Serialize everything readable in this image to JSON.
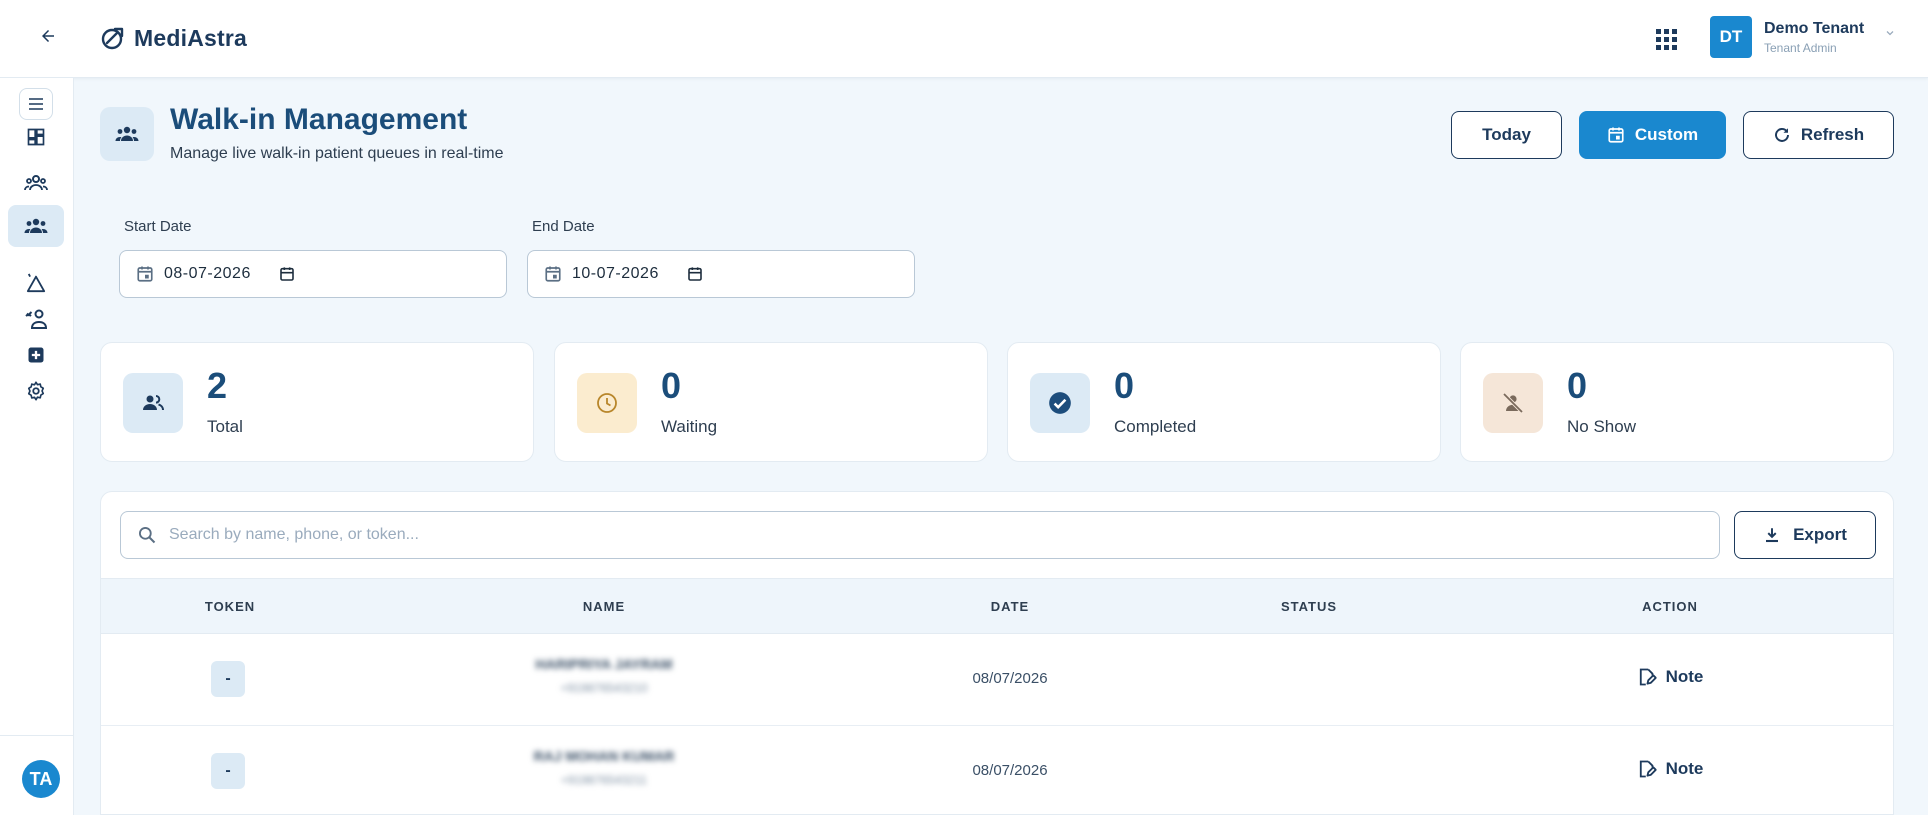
{
  "app": {
    "brand": "MediAstra"
  },
  "user": {
    "initials": "DT",
    "name": "Demo Tenant",
    "role": "Tenant Admin"
  },
  "sidebar": {
    "items": [
      {
        "name": "dashboard",
        "icon": "dashboard-icon",
        "active": false
      },
      {
        "name": "patients",
        "icon": "patients-icon",
        "active": false
      },
      {
        "name": "support",
        "icon": "headset-icon",
        "active": false
      },
      {
        "name": "walk-in",
        "icon": "walk-in-icon",
        "active": true
      },
      {
        "name": "services",
        "icon": "delta-icon",
        "active": false
      },
      {
        "name": "staff",
        "icon": "staff-icon",
        "active": false
      },
      {
        "name": "medical",
        "icon": "medical-plus-icon",
        "active": false
      },
      {
        "name": "settings",
        "icon": "gear-icon",
        "active": false
      }
    ],
    "footer_avatar": "TA"
  },
  "header": {
    "title": "Walk-in Management",
    "subtitle": "Manage live walk-in patient queues in real-time",
    "buttons": {
      "today": "Today",
      "custom": "Custom",
      "refresh": "Refresh"
    }
  },
  "filters": {
    "start_label": "Start Date",
    "start_value": "08-07-2026",
    "end_label": "End Date",
    "end_value": "10-07-2026"
  },
  "stats": [
    {
      "value": "2",
      "label": "Total",
      "icon": "group-icon",
      "bg": "#dceaf5"
    },
    {
      "value": "0",
      "label": "Waiting",
      "icon": "clock-icon",
      "bg": "#fbeccf"
    },
    {
      "value": "0",
      "label": "Completed",
      "icon": "check-circle-icon",
      "bg": "#dceaf5"
    },
    {
      "value": "0",
      "label": "No Show",
      "icon": "person-off-icon",
      "bg": "#f5e6d8"
    }
  ],
  "table": {
    "search_placeholder": "Search by name, phone, or token...",
    "export_label": "Export",
    "columns": [
      "TOKEN",
      "NAME",
      "DATE",
      "STATUS",
      "ACTION"
    ],
    "rows": [
      {
        "token": "-",
        "name": "HARIPRIYA JAYRAM",
        "phone": "+919876543210",
        "date": "08/07/2026",
        "status": "",
        "action": "Note"
      },
      {
        "token": "-",
        "name": "RAJ MOHAN KUMAR",
        "phone": "+919876543211",
        "date": "08/07/2026",
        "status": "",
        "action": "Note"
      }
    ]
  },
  "colors": {
    "accent": "#1a88cf",
    "navy": "#1d3a5c",
    "title": "#1b4d7a",
    "page_bg": "#f1f7fc"
  }
}
